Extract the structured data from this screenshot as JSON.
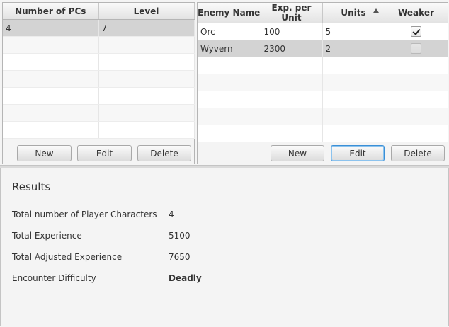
{
  "pcs_table": {
    "columns": [
      "Number of PCs",
      "Level"
    ],
    "rows": [
      {
        "pcs": "4",
        "level": "7"
      }
    ],
    "buttons": {
      "new": "New",
      "edit": "Edit",
      "delete": "Delete"
    }
  },
  "enemy_table": {
    "columns": [
      "Enemy Name",
      "Exp. per Unit",
      "Units",
      "Weaker"
    ],
    "sorted_column": "Units",
    "rows": [
      {
        "name": "Orc",
        "exp": "100",
        "units": "5",
        "weaker": true
      },
      {
        "name": "Wyvern",
        "exp": "2300",
        "units": "2",
        "weaker": false
      }
    ],
    "buttons": {
      "new": "New",
      "edit": "Edit",
      "delete": "Delete"
    }
  },
  "results": {
    "title": "Results",
    "items": [
      {
        "label": "Total number of Player Characters",
        "value": "4"
      },
      {
        "label": "Total Experience",
        "value": "5100"
      },
      {
        "label": "Total Adjusted Experience",
        "value": "7650"
      },
      {
        "label": "Encounter Difficulty",
        "value": "Deadly"
      }
    ]
  }
}
